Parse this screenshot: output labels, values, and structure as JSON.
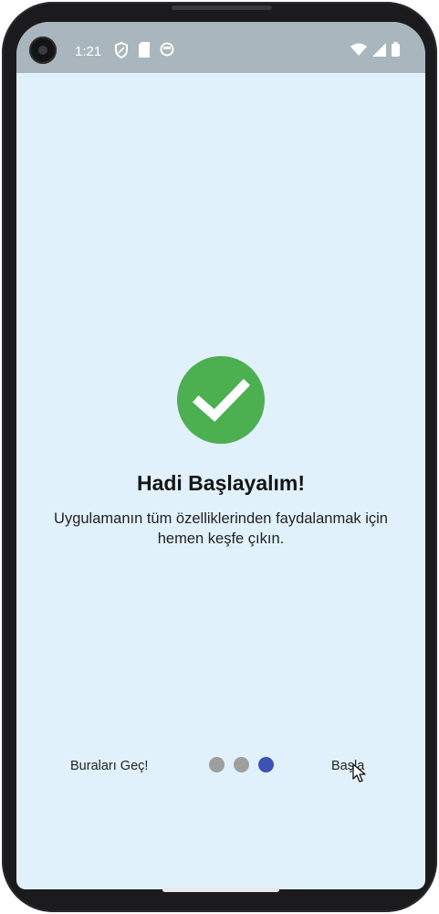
{
  "status_bar": {
    "time": "1:21",
    "left_icons": [
      "shield-icon",
      "sim-card-icon",
      "face-icon"
    ],
    "right_icons": [
      "wifi-icon",
      "signal-icon",
      "battery-icon"
    ]
  },
  "onboarding": {
    "icon": "check-circle-icon",
    "icon_color": "#4caf50",
    "title": "Hadi Başlayalım!",
    "subtitle": "Uygulamanın tüm özelliklerinden faydalanmak için hemen keşfe çıkın."
  },
  "navigation": {
    "skip_label": "Buraları Geç!",
    "start_label": "Başla",
    "page_count": 3,
    "current_page": 3,
    "dot_color": "#9e9e9e",
    "active_dot_color": "#3f51b5"
  },
  "colors": {
    "background": "#e1f1fb",
    "status_bar": "#a9b6bd"
  }
}
